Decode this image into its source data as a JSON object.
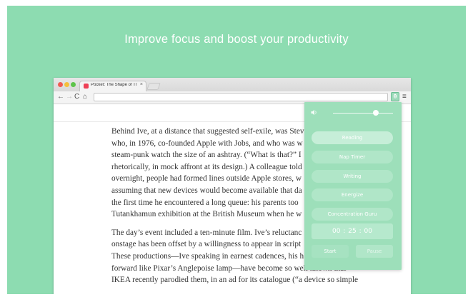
{
  "banner": {
    "headline": "Improve focus and boost your productivity"
  },
  "browser": {
    "tab": {
      "title": "Pocket: The Shape of Thin",
      "close_glyph": "×",
      "favicon": "pocket-icon"
    },
    "toolbar": {
      "back_glyph": "←",
      "forward_glyph": "→",
      "reload_glyph": "C",
      "home_glyph": "⌂",
      "menu_glyph": "≡",
      "extension_icon": "leaf-icon"
    }
  },
  "article": {
    "paragraphs": [
      [
        "Behind Ive, at a distance that suggested self-exile, was Stev",
        "who, in 1976, co-founded Apple with Jobs, and who was w",
        "steam-punk watch the size of an ashtray. (“What is that?” I",
        "rhetorically, in mock affront at its design.) A colleague told",
        "overnight, people had formed lines outside Apple stores, w",
        "assuming that new devices would become available that da",
        "the first time he encountered a long queue: his parents too",
        "Tutankhamun exhibition at the British Museum when he w"
      ],
      [
        "The day’s event included a ten-minute film. Ive’s reluctanc",
        "onstage has been offset by a willingness to appear in script",
        "These productions—Ive speaking in earnest cadences, his h",
        "forward like Pixar’s Anglepoise lamp—have become so well known that",
        "IKEA recently parodied them, in an ad for its catalogue (“a device so simple"
      ]
    ]
  },
  "popup": {
    "volume_icon": "speaker-icon",
    "volume_level": 0.72,
    "modes": [
      {
        "label": "Reading",
        "active": true
      },
      {
        "label": "Nap Timer",
        "active": false
      },
      {
        "label": "Writing",
        "active": false
      },
      {
        "label": "Energize",
        "active": false
      },
      {
        "label": "Concentration Guru",
        "active": false
      }
    ],
    "timer": {
      "hours": "00",
      "minutes": "25",
      "seconds": "00",
      "separator": ":"
    },
    "start_label": "Start",
    "pause_label": "Pause"
  },
  "colors": {
    "background": "#8ddcb1",
    "popup": "#9ddfba",
    "pocket_red": "#ee4056"
  }
}
